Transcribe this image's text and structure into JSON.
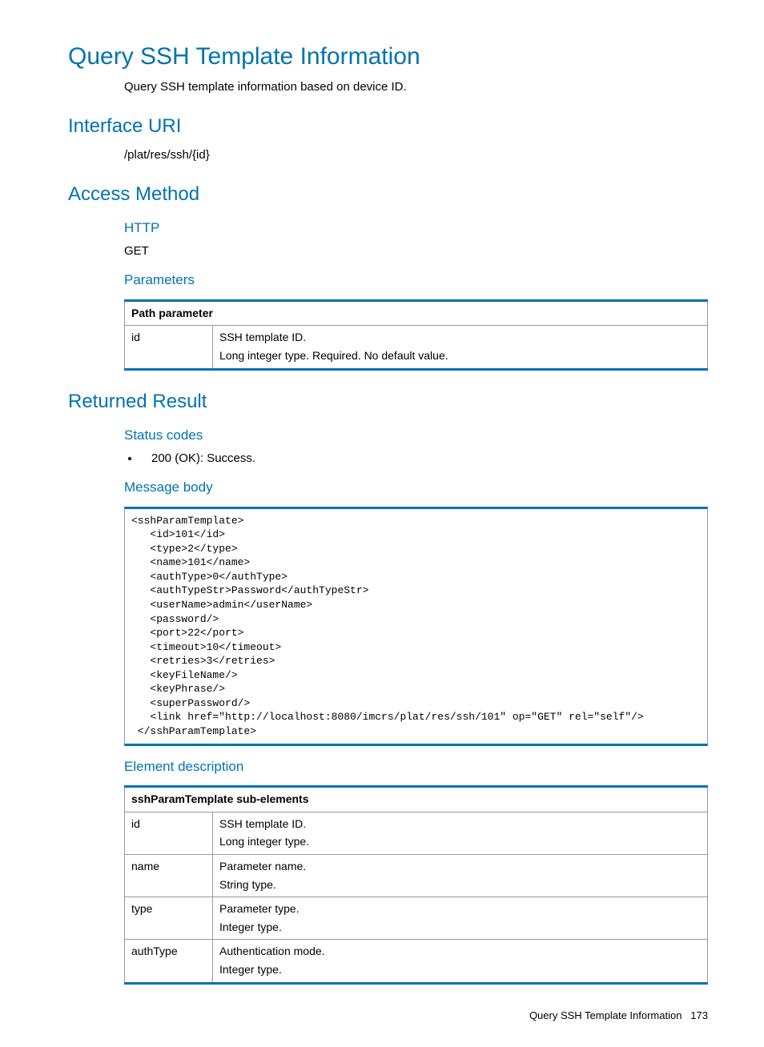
{
  "pageTitle": "Query SSH Template Information",
  "pageDesc": "Query SSH template information based on device ID.",
  "interfaceUri": {
    "heading": "Interface URI",
    "value": "/plat/res/ssh/{id}"
  },
  "accessMethod": {
    "heading": "Access Method",
    "http": {
      "label": "HTTP",
      "value": "GET"
    },
    "parameters": {
      "label": "Parameters",
      "tableHeader": "Path parameter",
      "rows": [
        {
          "name": "id",
          "line1": "SSH template ID.",
          "line2": "Long integer type. Required. No default value."
        }
      ]
    }
  },
  "returnedResult": {
    "heading": "Returned Result",
    "statusCodes": {
      "label": "Status codes",
      "items": [
        "200 (OK): Success."
      ]
    },
    "messageBody": {
      "label": "Message body",
      "code": "<sshParamTemplate>\n   <id>101</id>\n   <type>2</type>\n   <name>101</name>\n   <authType>0</authType>\n   <authTypeStr>Password</authTypeStr>\n   <userName>admin</userName>\n   <password/>\n   <port>22</port>\n   <timeout>10</timeout>\n   <retries>3</retries>\n   <keyFileName/>\n   <keyPhrase/>\n   <superPassword/>\n   <link href=\"http://localhost:8080/imcrs/plat/res/ssh/101\" op=\"GET\" rel=\"self\"/>\n </sshParamTemplate>"
    },
    "elementDescription": {
      "label": "Element description",
      "tableHeader": "sshParamTemplate sub-elements",
      "rows": [
        {
          "name": "id",
          "line1": "SSH template ID.",
          "line2": "Long integer type."
        },
        {
          "name": "name",
          "line1": "Parameter name.",
          "line2": "String type."
        },
        {
          "name": "type",
          "line1": "Parameter type.",
          "line2": "Integer type."
        },
        {
          "name": "authType",
          "line1": "Authentication mode.",
          "line2": "Integer type."
        }
      ]
    }
  },
  "footer": {
    "title": "Query SSH Template Information",
    "pageNum": "173"
  }
}
